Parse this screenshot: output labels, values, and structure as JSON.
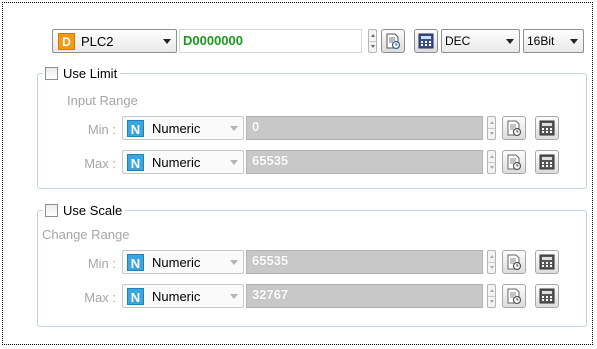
{
  "address_row": {
    "device_badge": "D",
    "device_name": "PLC2",
    "address": "D0000000",
    "format": "DEC",
    "bit_width": "16Bit"
  },
  "use_limit": {
    "title": "Use Limit",
    "checked": false,
    "subtitle": "Input Range",
    "rows": [
      {
        "label": "Min :",
        "type_badge": "N",
        "type": "Numeric",
        "value": "0"
      },
      {
        "label": "Max :",
        "type_badge": "N",
        "type": "Numeric",
        "value": "65535"
      }
    ]
  },
  "use_scale": {
    "title": "Use Scale",
    "checked": false,
    "subtitle": "Change Range",
    "rows": [
      {
        "label": "Min :",
        "type_badge": "N",
        "type": "Numeric",
        "value": "65535"
      },
      {
        "label": "Max :",
        "type_badge": "N",
        "type": "Numeric",
        "value": "32767"
      }
    ]
  },
  "colors": {
    "device_badge": "#f39c12",
    "numeric_badge": "#39a6e0",
    "address_text": "#1a9a1a",
    "group_border": "#c5d3e6",
    "disabled_field": "#c8c8c8"
  },
  "icons": [
    "address-browse-icon",
    "keypad-icon"
  ]
}
